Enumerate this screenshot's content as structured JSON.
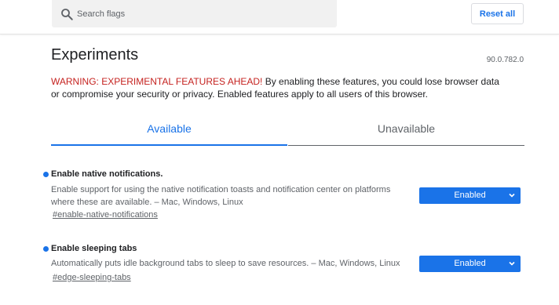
{
  "search": {
    "placeholder": "Search flags",
    "value": ""
  },
  "header": {
    "reset_label": "Reset all"
  },
  "page": {
    "title": "Experiments",
    "version": "90.0.782.0",
    "warning_prefix": "WARNING: EXPERIMENTAL FEATURES AHEAD!",
    "warning_body": " By enabling these features, you could lose browser data or compromise your security or privacy. Enabled features apply to all users of this browser."
  },
  "tabs": [
    {
      "label": "Available",
      "active": true
    },
    {
      "label": "Unavailable",
      "active": false
    }
  ],
  "flags": [
    {
      "name": "Enable native notifications.",
      "description": "Enable support for using the native notification toasts and notification center on platforms where these are available. – Mac, Windows, Linux",
      "link": "#enable-native-notifications",
      "value": "Enabled"
    },
    {
      "name": "Enable sleeping tabs",
      "description": "Automatically puts idle background tabs to sleep to save resources. – Mac, Windows, Linux",
      "link": "#edge-sleeping-tabs",
      "value": "Enabled"
    }
  ],
  "colors": {
    "accent": "#1a73e8",
    "warning": "#c5221f"
  },
  "icons": {
    "search": "search-icon",
    "dropdown": "chevron-down-icon",
    "status": "modified-dot-icon"
  }
}
